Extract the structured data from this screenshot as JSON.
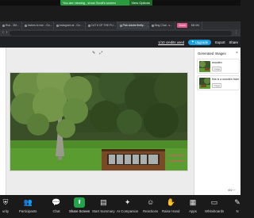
{
  "share_banner": {
    "message": "You are viewing , show Scott's screen",
    "view_options": "View Options"
  },
  "browser": {
    "tabs": [
      {
        "label": "Run - 3M...",
        "active": false
      },
      {
        "label": "Inches to mm - Go...",
        "active": false
      },
      {
        "label": "instagram.ai - Go...",
        "active": false
      },
      {
        "label": "CAT 6 OF THE FU...",
        "active": false
      },
      {
        "label": "Pick Adobe firefly...",
        "active": true
      },
      {
        "label": "Bing Chat - s...",
        "active": false
      }
    ],
    "pink_tab": "Zoom",
    "extra_tab": "M4 M4"
  },
  "app_header": {
    "credits": "1/10 credits used",
    "upgrade": "Upgrade",
    "export": "Export",
    "share": "Share"
  },
  "canvas": {
    "tools": [
      "edit-icon",
      "expand-icon"
    ]
  },
  "side_panel": {
    "title": "Generated Images",
    "cards": [
      {
        "caption": "wooden",
        "badge": "Image"
      },
      {
        "caption": "this is a wooden frame",
        "badge": "Image"
      }
    ],
    "pager": "4/4 ‹ ›"
  },
  "zoom_bar": {
    "items": [
      {
        "label": "urity",
        "icon": "shield-icon"
      },
      {
        "label": "Participants",
        "icon": "participants-icon"
      },
      {
        "label": "Chat",
        "icon": "chat-icon"
      },
      {
        "label": "Share Screen",
        "icon": "share-screen-icon"
      },
      {
        "label": "Start Summary",
        "icon": "summary-icon"
      },
      {
        "label": "AI Companion",
        "icon": "ai-companion-icon"
      },
      {
        "label": "Reactions",
        "icon": "reactions-icon"
      },
      {
        "label": "Raise Hand",
        "icon": "raise-hand-icon"
      },
      {
        "label": "Apps",
        "icon": "apps-icon"
      },
      {
        "label": "Whiteboards",
        "icon": "whiteboards-icon"
      },
      {
        "label": "N",
        "icon": "notes-icon"
      }
    ]
  }
}
